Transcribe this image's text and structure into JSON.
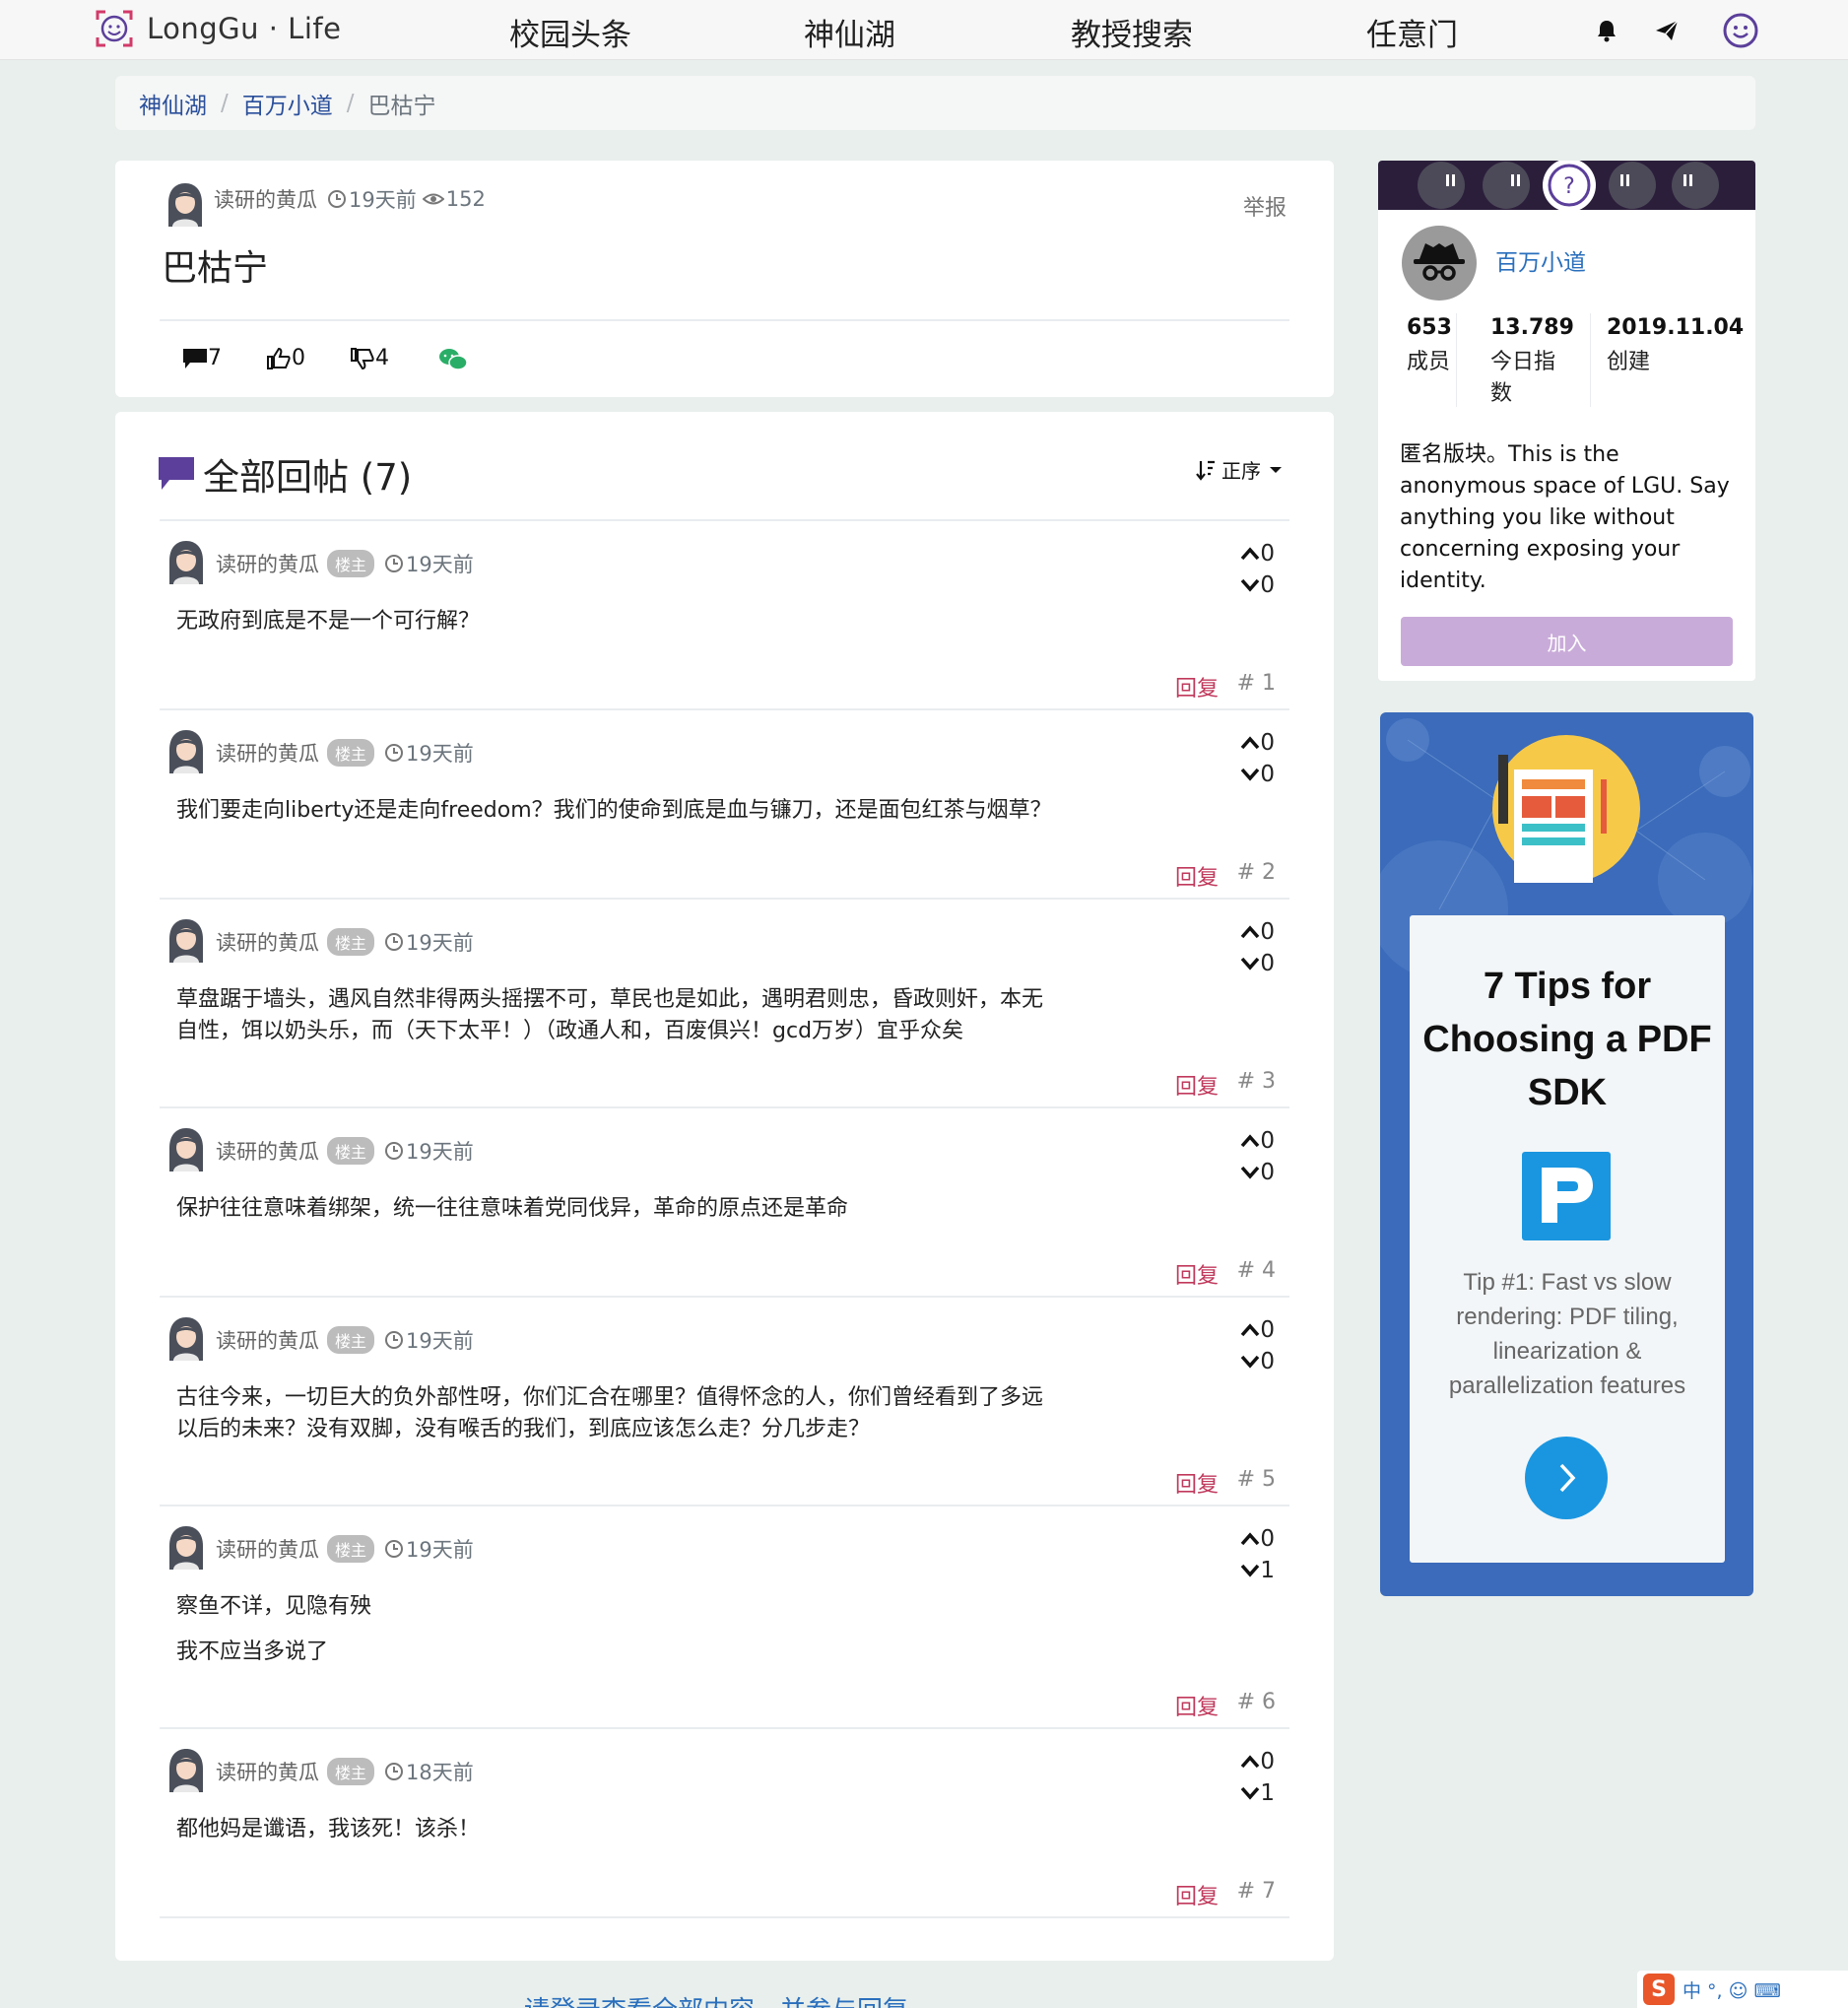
{
  "brand": {
    "name": "LongGu · Life"
  },
  "nav": {
    "items": [
      "校园头条",
      "神仙湖",
      "教授搜索",
      "任意门"
    ],
    "icons": [
      "bell-icon",
      "send-icon",
      "profile-icon"
    ]
  },
  "breadcrumb": {
    "items": [
      "神仙湖",
      "百万小道"
    ],
    "current": "巴枯宁"
  },
  "post": {
    "author": "读研的黄瓜",
    "time": "19天前",
    "views": "152",
    "report": "举报",
    "title": "巴枯宁",
    "comments": "7",
    "likes": "0",
    "dislikes": "4"
  },
  "replies": {
    "title": "全部回帖 (7)",
    "sort": "正序",
    "op_badge": "楼主",
    "reply_label": "回复",
    "items": [
      {
        "author": "读研的黄瓜",
        "time": "19天前",
        "lines": [
          "无政府到底是不是一个可行解？"
        ],
        "up": "0",
        "down": "0",
        "floor": "# 1"
      },
      {
        "author": "读研的黄瓜",
        "time": "19天前",
        "lines": [
          "我们要走向liberty还是走向freedom？我们的使命到底是血与镰刀，还是面包红茶与烟草？"
        ],
        "up": "0",
        "down": "0",
        "floor": "# 2"
      },
      {
        "author": "读研的黄瓜",
        "time": "19天前",
        "lines": [
          "草盘踞于墙头，遇风自然非得两头摇摆不可，草民也是如此，遇明君则忠，昏政则奸，本无",
          "自性，饵以奶头乐，而（天下太平！）（政通人和，百废俱兴！gcd万岁）宜乎众矣"
        ],
        "up": "0",
        "down": "0",
        "floor": "# 3"
      },
      {
        "author": "读研的黄瓜",
        "time": "19天前",
        "lines": [
          "保护往往意味着绑架，统一往往意味着党同伐异，革命的原点还是革命"
        ],
        "up": "0",
        "down": "0",
        "floor": "# 4"
      },
      {
        "author": "读研的黄瓜",
        "time": "19天前",
        "lines": [
          "古往今来，一切巨大的负外部性呀，你们汇合在哪里？值得怀念的人，你们曾经看到了多远",
          "以后的未来？没有双脚，没有喉舌的我们，到底应该怎么走？分几步走？"
        ],
        "up": "0",
        "down": "0",
        "floor": "# 5"
      },
      {
        "author": "读研的黄瓜",
        "time": "19天前",
        "lines": [
          "察鱼不详，见隐有殃",
          "我不应当多说了"
        ],
        "up": "0",
        "down": "1",
        "floor": "# 6"
      },
      {
        "author": "读研的黄瓜",
        "time": "18天前",
        "lines": [
          "都他妈是谶语，我该死！该杀！"
        ],
        "up": "0",
        "down": "1",
        "floor": "# 7"
      }
    ]
  },
  "board": {
    "name": "百万小道",
    "stats": [
      {
        "value": "653",
        "label": "成员"
      },
      {
        "value": "13.789",
        "label": "今日指数"
      },
      {
        "value": "2019.11.04",
        "label": "创建"
      }
    ],
    "description": "匿名版块。This is the anonymous space of LGU. Say anything you like without concerning exposing your identity.",
    "join": "加入"
  },
  "ad": {
    "title": "7 Tips for Choosing a PDF SDK",
    "body": "Tip #1: Fast vs slow rendering: PDF tiling, linearization & parallelization features"
  },
  "footer": {
    "login_prompt": "请登录查看全部内容，并参与回复"
  },
  "ime": {
    "label": "中 °, ☺ ⌨"
  },
  "colors": {
    "accent": "#2a6fbd",
    "reply": "#c0395c",
    "join": "#c9abd9",
    "purple": "#5b3f9a"
  }
}
